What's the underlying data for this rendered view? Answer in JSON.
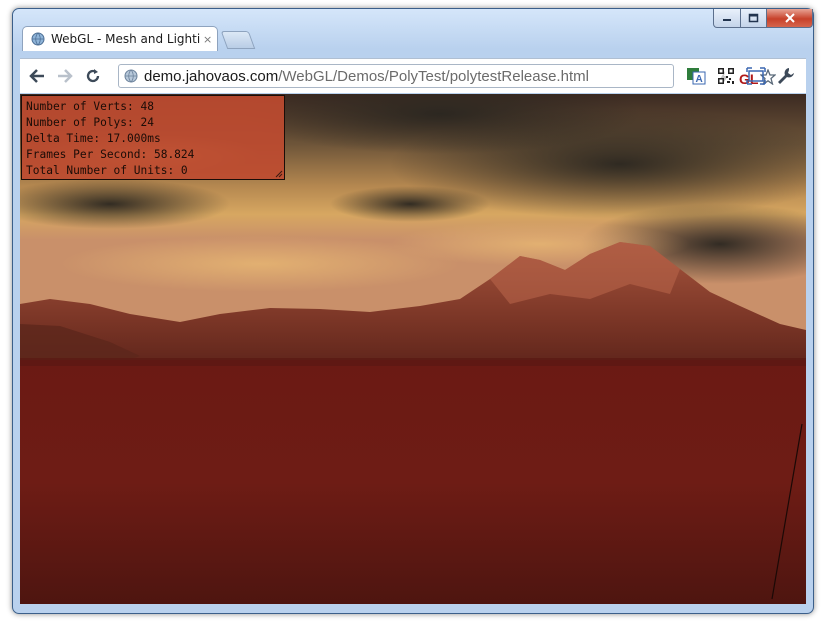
{
  "window": {
    "title_tab": "WebGL - Mesh and Lighting"
  },
  "tab": {
    "close_glyph": "×"
  },
  "address": {
    "host": "demo.jahovaos.com",
    "path": "/WebGL/Demos/PolyTest/polytestRelease.html"
  },
  "toolbar": {
    "gl_label": "GL"
  },
  "hud": {
    "lines": [
      "Number of Verts: 48",
      "Number of Polys: 24",
      "Delta Time: 17.000ms",
      "Frames Per Second: 58.824",
      "Total Number of Units: 0"
    ]
  },
  "colors": {
    "terrain": "#6e1a14",
    "hud_bg": "#be4b30",
    "sky_glow": "#d3a05c"
  }
}
